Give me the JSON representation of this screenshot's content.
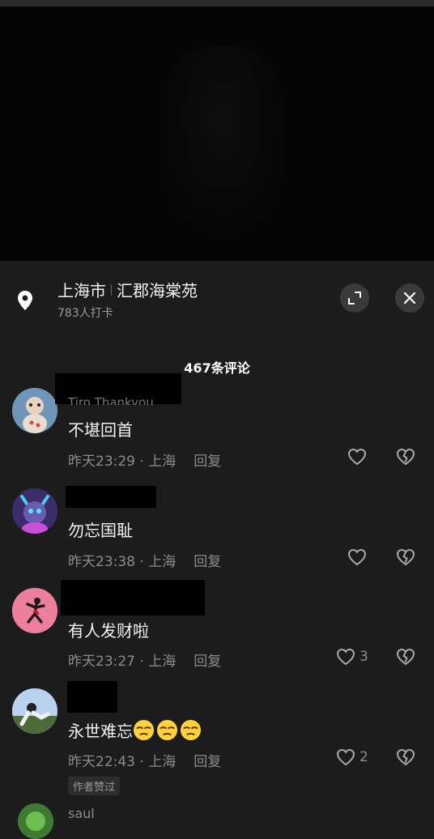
{
  "location": {
    "city": "上海市",
    "place": "汇郡海棠苑",
    "checkins": "783人打卡"
  },
  "comment_count_label": "467条评论",
  "comments": [
    {
      "partial_username": "Tiro Thankyou",
      "text": "不堪回首",
      "time": "昨天23:29",
      "region": "上海",
      "reply_label": "回复",
      "likes": ""
    },
    {
      "text": "勿忘国耻",
      "time": "昨天23:38",
      "region": "上海",
      "reply_label": "回复",
      "likes": ""
    },
    {
      "text": "有人发财啦",
      "time": "昨天23:27",
      "region": "上海",
      "reply_label": "回复",
      "likes": "3"
    },
    {
      "text": "永世难忘",
      "time": "昨天22:43",
      "region": "上海",
      "reply_label": "回复",
      "likes": "2",
      "badge": "作者赞过"
    }
  ],
  "next_comment_username": "saul",
  "meta_separator": " · ",
  "icons": [
    "location-pin-icon",
    "expand-icon",
    "close-icon",
    "heart-icon",
    "broken-heart-icon",
    "emoji-icon"
  ],
  "colors": {
    "background": "#1c1c1c",
    "text": "#f2f2f2",
    "muted": "#8c8c8c",
    "button": "#3a3a3a"
  }
}
